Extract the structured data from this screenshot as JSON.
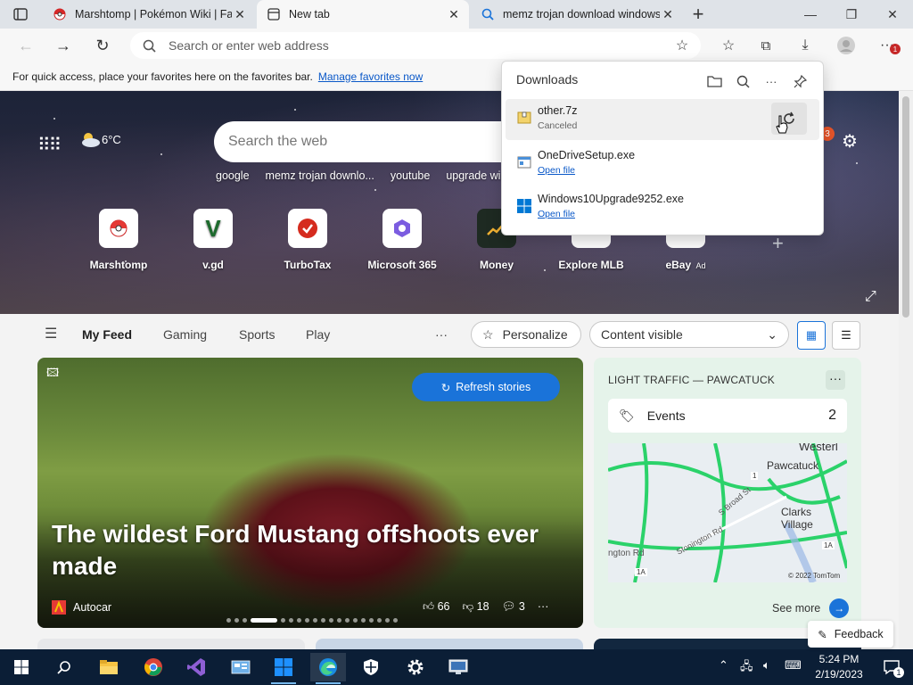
{
  "tabs": [
    {
      "title": "Marshtomp | Pokémon Wiki | Fan",
      "icon": "pokeball-icon"
    },
    {
      "title": "New tab",
      "icon": "newtab-icon",
      "active": true
    },
    {
      "title": "memz trojan download windows",
      "icon": "search-icon"
    }
  ],
  "toolbar": {
    "address_placeholder": "Search or enter web address",
    "badge": "1"
  },
  "favbar": {
    "text": "For quick access, place your favorites here on the favorites bar.",
    "link": "Manage favorites now"
  },
  "ntp": {
    "weather": "6°C",
    "search_placeholder": "Search the web",
    "suggestions": [
      "google",
      "memz trojan downlo...",
      "youtube",
      "upgrade windo"
    ],
    "tiles": [
      {
        "label": "Marshtomp",
        "icon": "pokeball-icon"
      },
      {
        "label": "v.gd",
        "icon": "v-icon"
      },
      {
        "label": "TurboTax",
        "icon": "checkmark-icon"
      },
      {
        "label": "Microsoft 365",
        "icon": "m365-icon"
      },
      {
        "label": "Money",
        "icon": "money-icon"
      },
      {
        "label": "Explore MLB",
        "icon": "mlb-icon"
      },
      {
        "label": "eBay",
        "ad": "Ad",
        "icon": "ebay-icon"
      }
    ],
    "notif_count": "3"
  },
  "feednav": {
    "items": [
      "My Feed",
      "Gaming",
      "Sports",
      "Play"
    ],
    "more": "···",
    "personalize": "Personalize",
    "content": "Content visible"
  },
  "story": {
    "refresh": "Refresh stories",
    "headline": "The wildest Ford Mustang offshoots ever made",
    "source": "Autocar",
    "likes": "66",
    "dislikes": "18",
    "comments": "3",
    "more": "···"
  },
  "traffic": {
    "title": "LIGHT TRAFFIC — PAWCATUCK",
    "events_label": "Events",
    "events_count": "2",
    "map_labels": [
      "Westerl",
      "Pawcatuck",
      "Clarks",
      "Village",
      "Stonington Rd",
      "S Broad St",
      "ngton Rd",
      "1A",
      "1A",
      "1",
      "© 2022 TomTom"
    ],
    "see_more": "See more"
  },
  "feedback": "Feedback",
  "downloads": {
    "title": "Downloads",
    "items": [
      {
        "name": "other.7z",
        "status": "Canceled"
      },
      {
        "name": "OneDriveSetup.exe",
        "status": "Open file"
      },
      {
        "name": "Windows10Upgrade9252.exe",
        "status": "Open file"
      }
    ]
  },
  "taskbar": {
    "time": "5:24 PM",
    "date": "2/19/2023",
    "notif": "1"
  }
}
